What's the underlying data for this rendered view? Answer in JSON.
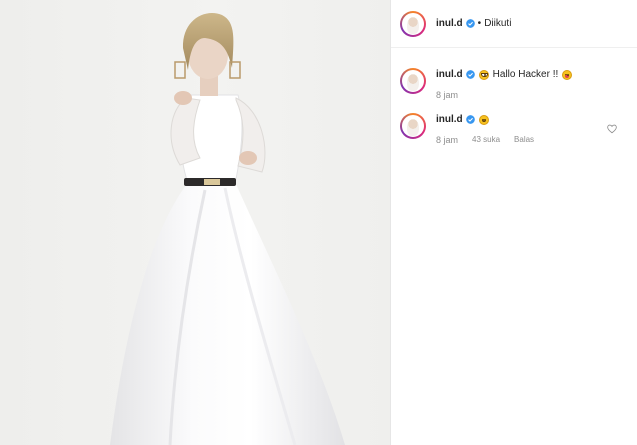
{
  "header": {
    "username": "inul.d",
    "separator": "•",
    "follow_status": "Diikuti"
  },
  "comments": [
    {
      "username": "inul.d",
      "text": "Hallo Hacker !!",
      "emojis_before": [
        "grinning-face-emoji"
      ],
      "emojis_after": [
        "tongue-out-emoji"
      ],
      "time": "8 jam",
      "likes": "",
      "reply": ""
    },
    {
      "username": "inul.d",
      "text": "",
      "emojis_before": [
        "smiling-face-emoji"
      ],
      "time": "8 jam",
      "likes": "43 suka",
      "reply": "Balas"
    }
  ],
  "icons": {
    "verified": "verified-badge-icon",
    "like": "heart-icon"
  },
  "colors": {
    "verified_blue": "#3897f0",
    "muted_text": "#8e8e8e",
    "dress_white": "#ffffff"
  }
}
